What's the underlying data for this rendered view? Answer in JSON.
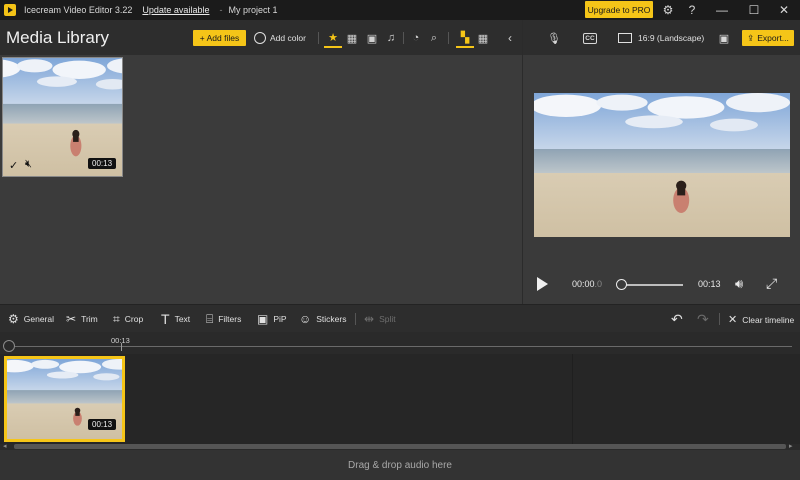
{
  "titlebar": {
    "app_title": "Icecream Video Editor 3.22",
    "update_link": "Update available",
    "separator": "-",
    "project_name": "My project 1",
    "upgrade_label": "Upgrade to PRO",
    "icons": [
      "gear-icon",
      "help-icon",
      "minimize-icon",
      "maximize-icon",
      "close-icon"
    ]
  },
  "library": {
    "title": "Media Library",
    "add_files_label": "+ Add files",
    "add_color_label": "Add color",
    "filters": [
      "all-icon",
      "video-icon",
      "image-icon",
      "audio-icon"
    ],
    "active_filter": "all",
    "items": [
      {
        "duration": "00:13",
        "selected": true,
        "muted": true
      }
    ]
  },
  "preview": {
    "aspect_label": "16:9 (Landscape)",
    "export_label": "Export...",
    "time_current": "00:00",
    "time_current_frac": ".0",
    "time_end": "00:13",
    "progress": 0
  },
  "editbar": {
    "tools": [
      {
        "label": "General",
        "icon": "gear-icon"
      },
      {
        "label": "Trim",
        "icon": "scissors-icon"
      },
      {
        "label": "Crop",
        "icon": "crop-icon"
      },
      {
        "label": "Text",
        "icon": "text-icon"
      },
      {
        "label": "Filters",
        "icon": "filter-icon"
      },
      {
        "label": "PiP",
        "icon": "pip-icon"
      },
      {
        "label": "Stickers",
        "icon": "sticker-icon"
      },
      {
        "label": "Split",
        "icon": "split-icon",
        "disabled": true
      }
    ],
    "clear_label": "Clear timeline"
  },
  "timeline": {
    "ruler_label": "00:13",
    "clips": [
      {
        "duration": "00:13"
      }
    ],
    "audio_drop_label": "Drag & drop audio here"
  },
  "colors": {
    "accent": "#f5c518",
    "background": "#2b2b2b",
    "panel": "#3b3b3b"
  }
}
